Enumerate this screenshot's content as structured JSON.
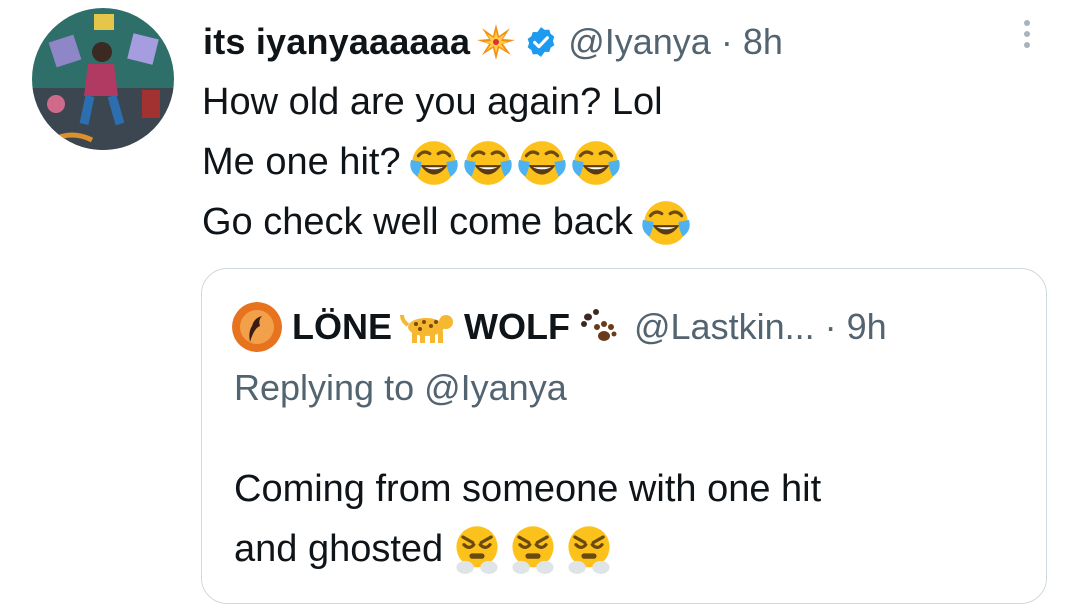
{
  "tweet": {
    "display_name": "its iyanyaaaaaa",
    "name_emoji": "collision-emoji",
    "verified_icon": "verified-badge-icon",
    "handle": "@Iyanya",
    "separator": "·",
    "time": "8h",
    "more_icon": "more-options-icon",
    "lines": [
      "How old are you again? Lol",
      "Me one hit?",
      "Go check well come back"
    ],
    "line_emojis": [
      "",
      "face-with-tears-of-joy x4",
      "face-with-tears-of-joy x1"
    ]
  },
  "quoted_tweet": {
    "name_part1": "LÖNE",
    "name_part2": "WOLF",
    "name_emojis": [
      "leopard-emoji",
      "paw-prints-emoji"
    ],
    "handle": "@Lastkin...",
    "separator": "·",
    "time": "9h",
    "replying_to": "Replying to @Iyanya",
    "lines": [
      "Coming from someone with one hit",
      "and ghosted"
    ],
    "line_emojis": [
      "",
      "face-with-steam-from-nose x3"
    ]
  },
  "colors": {
    "text": "#0f1419",
    "secondary": "#536471",
    "verified_blue": "#1d9bf0",
    "border": "#cfd9de",
    "emoji_yellow": "#fcc21b"
  }
}
